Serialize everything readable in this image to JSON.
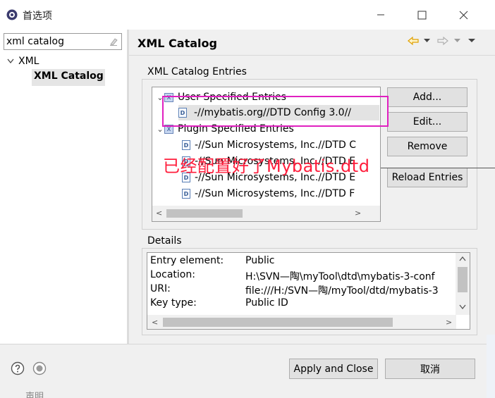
{
  "window": {
    "title": "首选项",
    "controls": {
      "minimize": "minimize",
      "maximize": "maximize",
      "close": "close"
    }
  },
  "filter": {
    "value": "xml catalog"
  },
  "nav_tree": {
    "parent": "XML",
    "selected": "XML Catalog"
  },
  "page": {
    "title": "XML Catalog"
  },
  "entries": {
    "group_label": "XML Catalog Entries",
    "user_specified": "User Specified Entries",
    "user_entry": "-//mybatis.org//DTD Config 3.0//",
    "plugin_specified": "Plugin Specified Entries",
    "plugin_entries": [
      "-//Sun Microsystems, Inc.//DTD C",
      "-//Sun Microsystems, Inc.//DTD E",
      "-//Sun Microsystems, Inc.//DTD E",
      "-//Sun Microsystems, Inc.//DTD F"
    ]
  },
  "buttons": {
    "add": "Add...",
    "edit": "Edit...",
    "remove": "Remove",
    "reload": "Reload Entries",
    "apply_close": "Apply and Close",
    "cancel": "取消"
  },
  "annotation": {
    "text": "已经配置好了Mybatis.dtd",
    "color": "#ff1e3c",
    "box_color": "#e020c0"
  },
  "details": {
    "group_label": "Details",
    "rows": [
      {
        "key": "Entry element:",
        "value": "Public"
      },
      {
        "key": "Location:",
        "value": "H:\\SVN—陶\\myTool\\dtd\\mybatis-3-conf"
      },
      {
        "key": "URI:",
        "value": "file:///H:/SVN—陶/myTool/dtd/mybatis-3"
      },
      {
        "key": "Key type:",
        "value": "Public ID"
      }
    ]
  },
  "footer": {
    "ghost_text": "声明"
  },
  "colors": {
    "selection": "#e3e3e3",
    "pane_bg": "#f0f0f0",
    "nav_arrow": "#e0a000"
  }
}
